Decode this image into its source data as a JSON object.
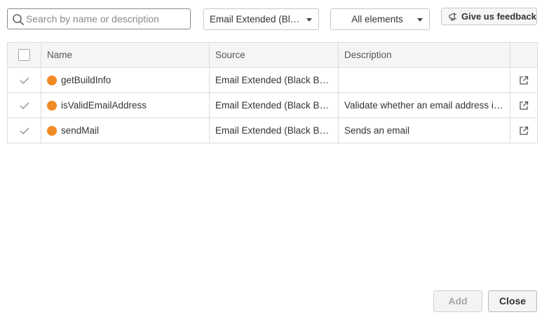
{
  "search": {
    "placeholder": "Search by name or description",
    "value": "",
    "icon": "search-icon"
  },
  "filters": {
    "source": "Email Extended (Black Belt ...",
    "elements": "All elements"
  },
  "feedback_button": {
    "label": "Give us feedback",
    "icon": "megaphone-icon"
  },
  "table": {
    "headers": {
      "name": "Name",
      "source": "Source",
      "description": "Description"
    },
    "rows": [
      {
        "name": "getBuildInfo",
        "source": "Email Extended (Black Belt ...",
        "description": ""
      },
      {
        "name": "isValidEmailAddress",
        "source": "Email Extended (Black Belt ...",
        "description": "Validate whether an email address is o..."
      },
      {
        "name": "sendMail",
        "source": "Email Extended (Black Belt ...",
        "description": "Sends an email"
      }
    ]
  },
  "footer": {
    "add_label": "Add",
    "close_label": "Close"
  },
  "colors": {
    "action_dot": "#f28a26",
    "check": "#8a8a8a",
    "header_bg": "#f5f5f5",
    "border": "#dcdcdc"
  }
}
